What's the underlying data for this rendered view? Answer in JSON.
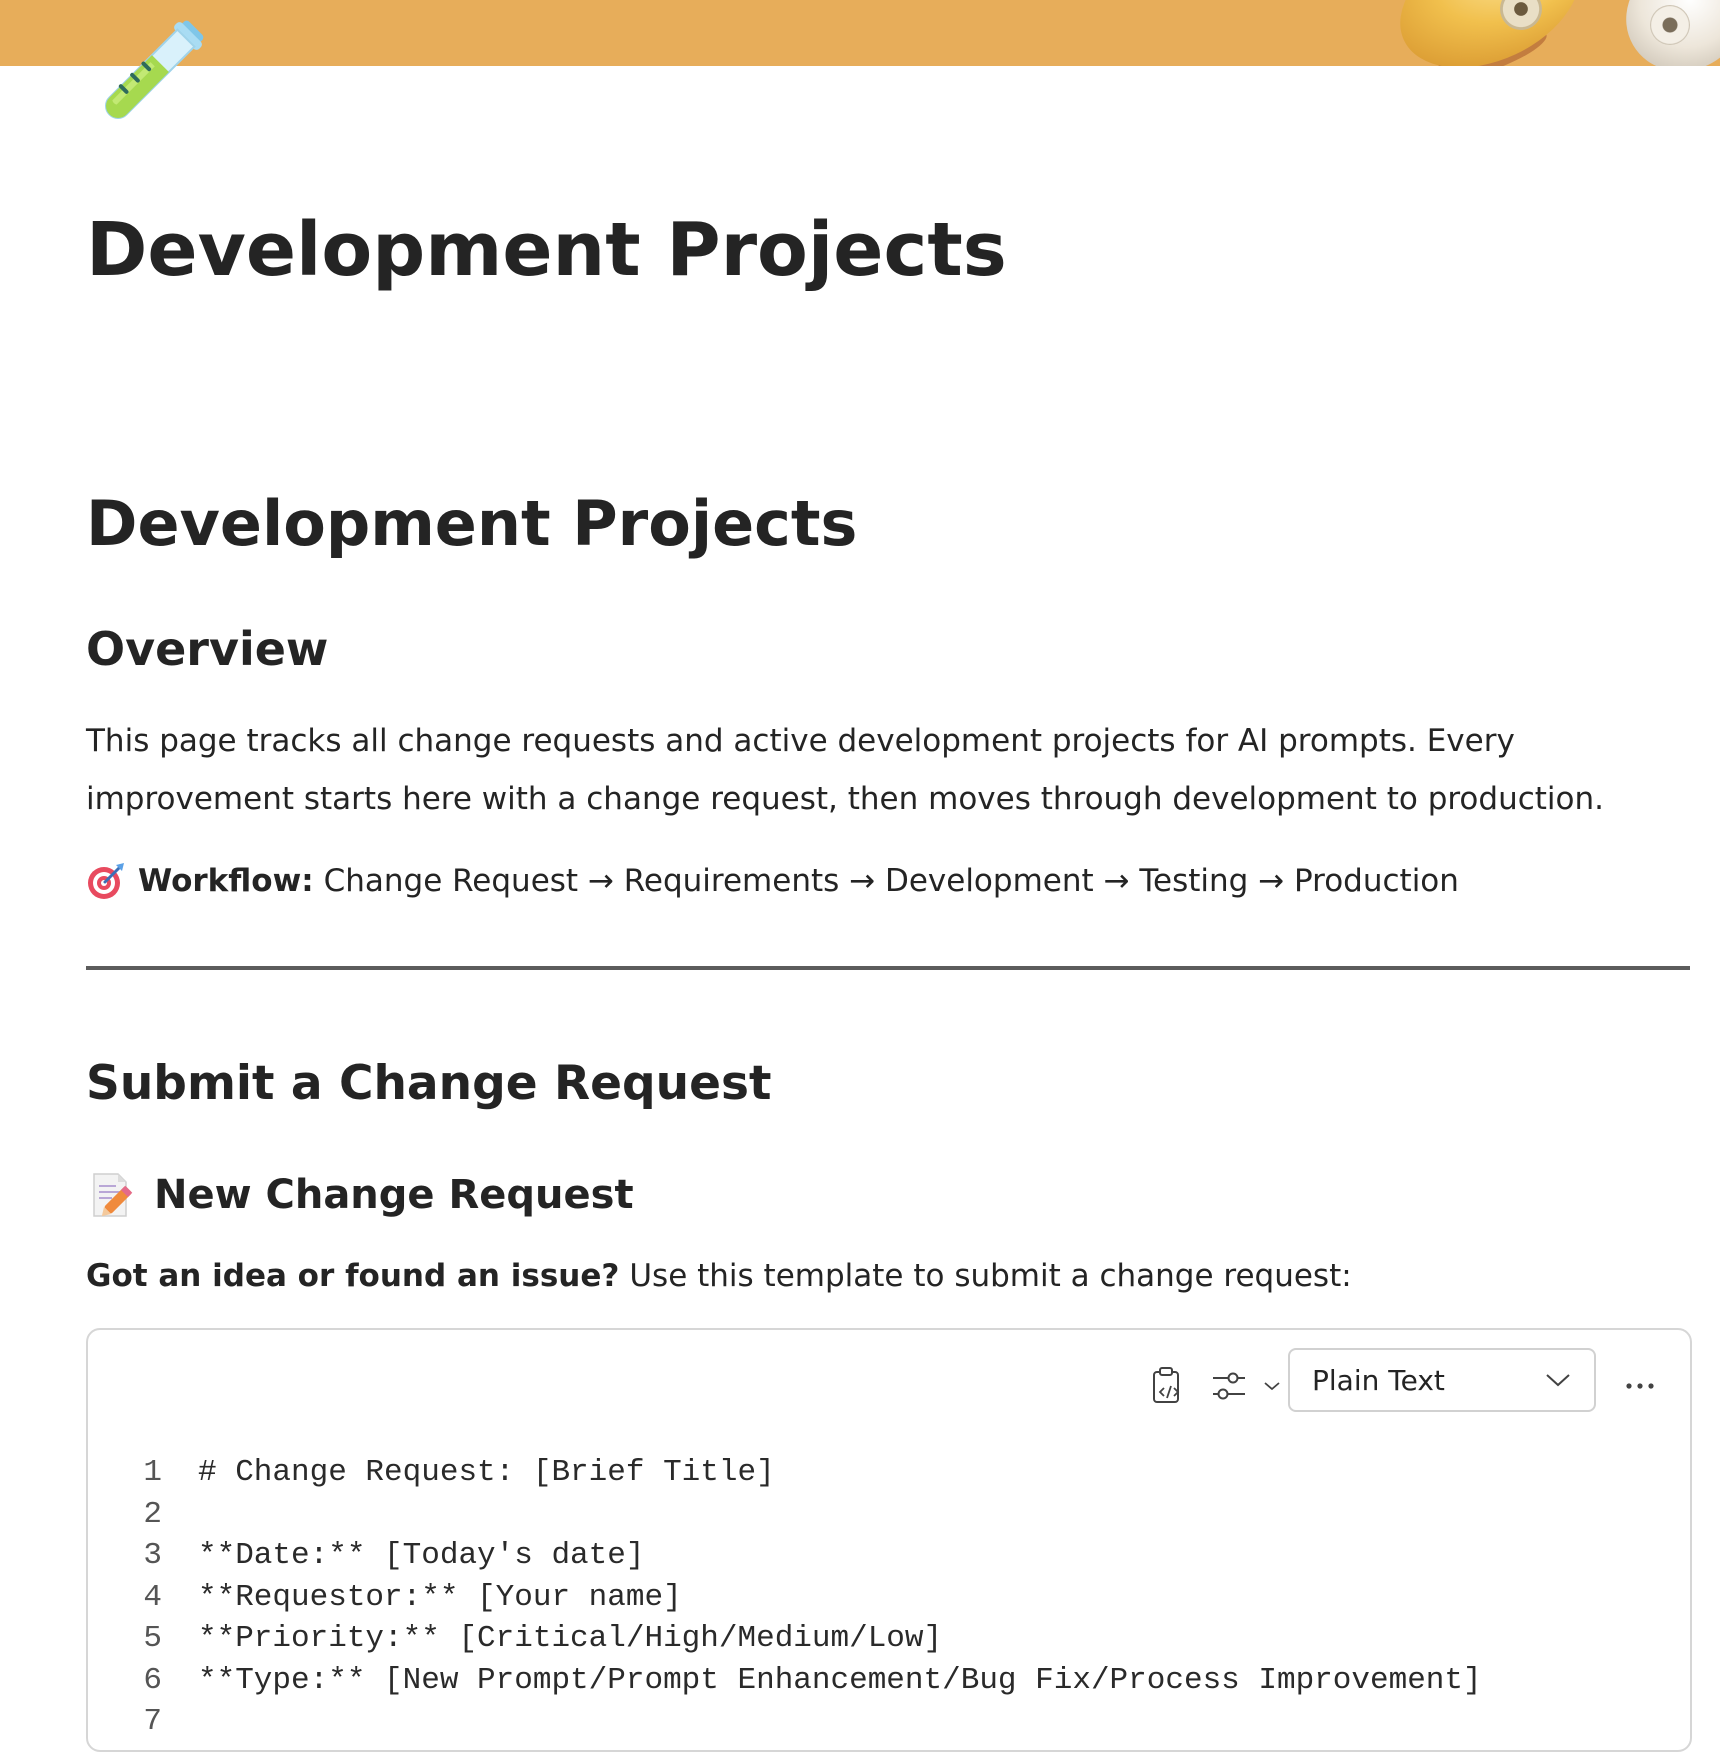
{
  "page": {
    "icon": "test-tube-icon",
    "title": "Development Projects"
  },
  "content": {
    "heading": "Development Projects",
    "overview": {
      "heading": "Overview",
      "text": "This page tracks all change requests and active development projects for AI prompts. Every improvement starts here with a change request, then moves through development to production."
    },
    "workflow": {
      "icon": "target-icon",
      "label": "Workflow:",
      "steps": "Change Request → Requirements → Development → Testing → Production"
    },
    "submit": {
      "heading": "Submit a Change Request",
      "subheading_icon": "memo-icon",
      "subheading": "New Change Request",
      "intro_bold": "Got an idea or found an issue?",
      "intro_rest": "Use this template to submit a change request:"
    }
  },
  "code_block": {
    "language": "Plain Text",
    "toolbar": {
      "copy_icon": "copy-code-icon",
      "settings_icon": "settings-sliders-icon",
      "more_icon": "more-icon"
    },
    "lines": [
      {
        "n": "1",
        "text": "# Change Request: [Brief Title]"
      },
      {
        "n": "2",
        "text": ""
      },
      {
        "n": "3",
        "text": "**Date:** [Today's date]"
      },
      {
        "n": "4",
        "text": "**Requestor:** [Your name]"
      },
      {
        "n": "5",
        "text": "**Priority:** [Critical/High/Medium/Low]"
      },
      {
        "n": "6",
        "text": "**Type:** [New Prompt/Prompt Enhancement/Bug Fix/Process Improvement]"
      },
      {
        "n": "7",
        "text": ""
      }
    ]
  },
  "colors": {
    "banner": "#e7ad5a",
    "text": "#242424",
    "divider": "#5c5c5c"
  }
}
